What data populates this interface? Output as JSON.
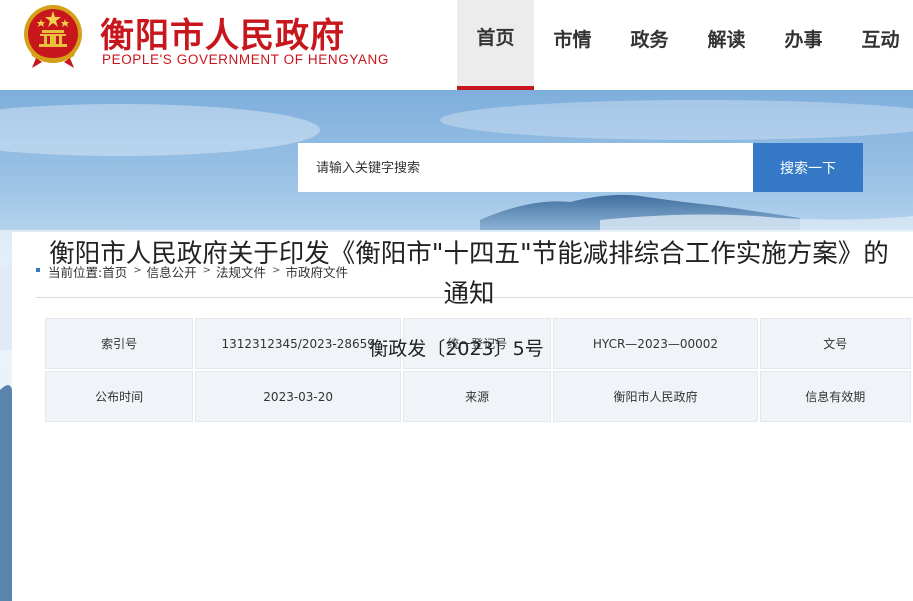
{
  "header": {
    "title": "衡阳市人民政府",
    "subtitle": "PEOPLE'S GOVERNMENT OF HENGYANG",
    "emblem_icon": "national-emblem-icon",
    "brand_color": "#c8161d"
  },
  "nav": {
    "items": [
      {
        "label": "首页",
        "active": true
      },
      {
        "label": "市情",
        "active": false
      },
      {
        "label": "政务",
        "active": false
      },
      {
        "label": "解读",
        "active": false
      },
      {
        "label": "办事",
        "active": false
      },
      {
        "label": "互动",
        "active": false
      }
    ]
  },
  "search": {
    "placeholder": "请输入关键字搜索",
    "button_label": "搜索一下",
    "button_color": "#3478c6"
  },
  "breadcrumb": {
    "prefix": "当前位置:",
    "items": [
      "首页",
      "信息公开",
      "法规文件",
      "市政府文件"
    ]
  },
  "info_table": {
    "rows": [
      [
        "索引号",
        "1312312345/2023-28659",
        "统一登记号",
        "HYCR—2023—00002",
        "文号"
      ],
      [
        "公布时间",
        "2023-03-20",
        "来源",
        "衡阳市人民政府",
        "信息有效期"
      ]
    ]
  },
  "document": {
    "title": "衡阳市人民政府关于印发《衡阳市\"十四五\"节能减排综合工作实施方案》的通知",
    "number": "衡政发〔2023〕5号"
  }
}
